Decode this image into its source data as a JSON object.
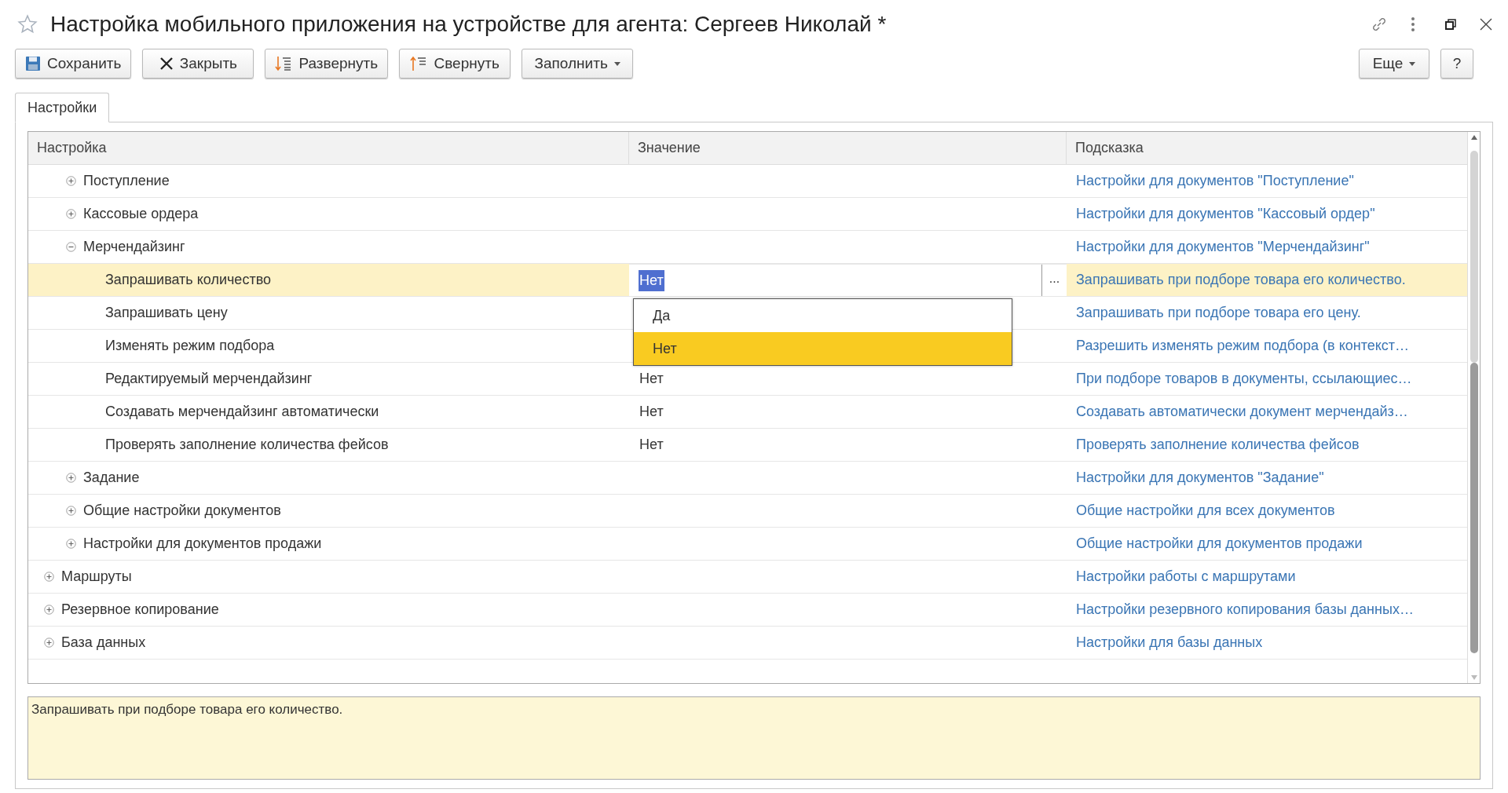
{
  "window": {
    "title": "Настройка мобильного приложения на устройстве для агента: Сергеев Николай *"
  },
  "toolbar": [
    {
      "kind": "save",
      "label": "Сохранить"
    },
    {
      "kind": "close",
      "label": "Закрыть"
    },
    {
      "kind": "expand",
      "label": "Развернуть"
    },
    {
      "kind": "collapse",
      "label": "Свернуть"
    },
    {
      "kind": "menu",
      "label": "Заполнить"
    }
  ],
  "toolbar_right": [
    {
      "kind": "menu",
      "label": "Еще"
    },
    {
      "kind": "plain",
      "label": "?"
    }
  ],
  "tabs": [
    {
      "label": "Настройки",
      "selected": true
    }
  ],
  "table": {
    "columns": [
      "Настройка",
      "Значение",
      "Подсказка"
    ],
    "rows": [
      {
        "children": [
          {
            "label": "Поступление",
            "expanded": false,
            "selected": false,
            "hint": "Настройки для документов \"Поступление\""
          },
          {
            "label": "Кассовые ордера",
            "expanded": false,
            "selected": false,
            "hint": "Настройки для документов \"Кассовый ордер\""
          },
          {
            "label": "Мерчендайзинг",
            "expanded": true,
            "selected": false,
            "hint": "Настройки для документов \"Мерчендайзинг\"",
            "children": [
              {
                "label": "Запрашивать количество",
                "selected": true,
                "value": "Нет",
                "editing": true,
                "choice_button": "...",
                "hint": "Запрашивать при подборе товара его количество.",
                "dropdown": [
                  {
                    "label": "Да",
                    "selected": false
                  },
                  {
                    "label": "Нет",
                    "selected": true
                  }
                ]
              },
              {
                "label": "Запрашивать цену",
                "selected": false,
                "hint": "Запрашивать при подборе товара его цену."
              },
              {
                "label": "Изменять режим подбора",
                "selected": false,
                "hint": "Разрешить изменять режим подбора (в контекст…"
              },
              {
                "label": "Редактируемый мерчендайзинг",
                "selected": false,
                "value": "Нет",
                "hint": "При подборе товаров в документы, ссылающиес…"
              },
              {
                "label": "Создавать мерчендайзинг автоматически",
                "selected": false,
                "value": "Нет",
                "hint": "Создавать автоматически документ мерчендайз…"
              },
              {
                "label": "Проверять заполнение количества фейсов",
                "selected": false,
                "value": "Нет",
                "hint": "Проверять заполнение количества фейсов"
              }
            ]
          },
          {
            "label": "Задание",
            "expanded": false,
            "selected": false,
            "hint": "Настройки для документов \"Задание\""
          },
          {
            "label": "Общие настройки документов",
            "expanded": false,
            "selected": false,
            "hint": "Общие настройки для всех документов"
          },
          {
            "label": "Настройки для документов продажи",
            "expanded": false,
            "selected": false,
            "hint": "Общие настройки для документов продажи"
          }
        ]
      },
      {
        "label": "Маршруты",
        "expanded": false,
        "selected": false,
        "hint": "Настройки работы с маршрутами"
      },
      {
        "label": "Резервное копирование",
        "expanded": false,
        "selected": false,
        "hint": "Настройки резервного копирования базы данных…"
      },
      {
        "label": "База данных",
        "expanded": false,
        "selected": false,
        "hint": "Настройки для базы данных"
      }
    ]
  },
  "details": {
    "value": "Запрашивать при подборе товара его количество."
  }
}
